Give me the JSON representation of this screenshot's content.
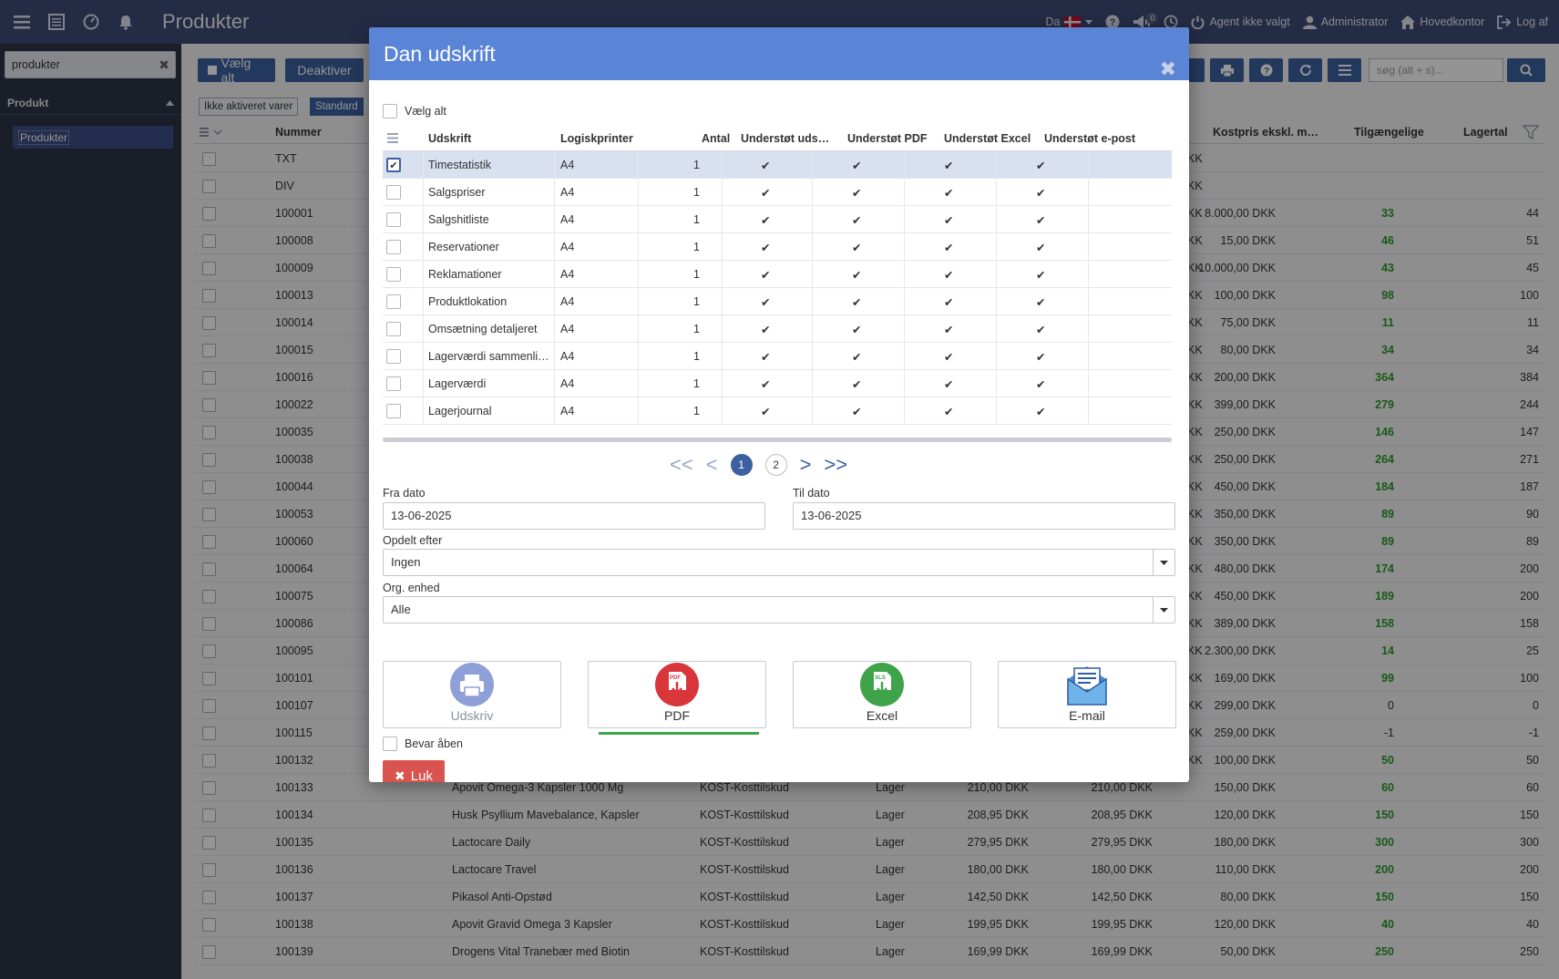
{
  "topbar": {
    "title": "Produkter",
    "language": "Da",
    "notification_count": "0",
    "agent": "Agent ikke valgt",
    "user": "Administrator",
    "office": "Hovedkontor",
    "logout": "Log af"
  },
  "sidebar": {
    "search_value": "produkter",
    "section": "Produkt",
    "item": "Produkter"
  },
  "toolbar": {
    "select_all": "Vælg alt",
    "deactivate": "Deaktiver",
    "search_placeholder": "søg (alt + s)..."
  },
  "filters": [
    "Ikke aktiveret varer",
    "Standard"
  ],
  "grid": {
    "headers": {
      "number": "Nummer",
      "cost": "Kostpris ekskl. m…",
      "available": "Tilgængelige",
      "stock": "Lagertal"
    },
    "rows": [
      {
        "num": "TXT",
        "name": "",
        "group": "",
        "type": "",
        "p1": "",
        "p2": "",
        "p3": "KK",
        "cost": "",
        "avail": "",
        "stock": ""
      },
      {
        "num": "DIV",
        "name": "",
        "group": "",
        "type": "",
        "p1": "",
        "p2": "",
        "p3": "KK",
        "cost": "",
        "avail": "",
        "stock": ""
      },
      {
        "num": "100001",
        "name": "",
        "group": "",
        "type": "",
        "p1": "",
        "p2": "",
        "p3": "KK",
        "cost": "8.000,00 DKK",
        "avail": "33",
        "stock": "44"
      },
      {
        "num": "100008",
        "name": "",
        "group": "",
        "type": "",
        "p1": "",
        "p2": "",
        "p3": "KK",
        "cost": "15,00 DKK",
        "avail": "46",
        "stock": "51"
      },
      {
        "num": "100009",
        "name": "",
        "group": "",
        "type": "",
        "p1": "",
        "p2": "",
        "p3": "KK",
        "cost": "10.000,00 DKK",
        "avail": "43",
        "stock": "45"
      },
      {
        "num": "100013",
        "name": "",
        "group": "",
        "type": "",
        "p1": "",
        "p2": "",
        "p3": "KK",
        "cost": "100,00 DKK",
        "avail": "98",
        "stock": "100"
      },
      {
        "num": "100014",
        "name": "",
        "group": "",
        "type": "",
        "p1": "",
        "p2": "",
        "p3": "KK",
        "cost": "75,00 DKK",
        "avail": "11",
        "stock": "11"
      },
      {
        "num": "100015",
        "name": "",
        "group": "",
        "type": "",
        "p1": "",
        "p2": "",
        "p3": "KK",
        "cost": "80,00 DKK",
        "avail": "34",
        "stock": "34"
      },
      {
        "num": "100016",
        "name": "",
        "group": "",
        "type": "",
        "p1": "",
        "p2": "",
        "p3": "KK",
        "cost": "200,00 DKK",
        "avail": "364",
        "stock": "384"
      },
      {
        "num": "100022",
        "name": "",
        "group": "",
        "type": "",
        "p1": "",
        "p2": "",
        "p3": "KK",
        "cost": "399,00 DKK",
        "avail": "279",
        "stock": "244"
      },
      {
        "num": "100035",
        "name": "",
        "group": "",
        "type": "",
        "p1": "",
        "p2": "",
        "p3": "KK",
        "cost": "250,00 DKK",
        "avail": "146",
        "stock": "147"
      },
      {
        "num": "100038",
        "name": "",
        "group": "",
        "type": "",
        "p1": "",
        "p2": "",
        "p3": "KK",
        "cost": "250,00 DKK",
        "avail": "264",
        "stock": "271"
      },
      {
        "num": "100044",
        "name": "",
        "group": "",
        "type": "",
        "p1": "",
        "p2": "",
        "p3": "KK",
        "cost": "450,00 DKK",
        "avail": "184",
        "stock": "187"
      },
      {
        "num": "100053",
        "name": "",
        "group": "",
        "type": "",
        "p1": "",
        "p2": "",
        "p3": "KK",
        "cost": "350,00 DKK",
        "avail": "89",
        "stock": "90"
      },
      {
        "num": "100060",
        "name": "",
        "group": "",
        "type": "",
        "p1": "",
        "p2": "",
        "p3": "KK",
        "cost": "350,00 DKK",
        "avail": "89",
        "stock": "89"
      },
      {
        "num": "100064",
        "name": "",
        "group": "",
        "type": "",
        "p1": "",
        "p2": "",
        "p3": "KK",
        "cost": "480,00 DKK",
        "avail": "174",
        "stock": "200"
      },
      {
        "num": "100075",
        "name": "",
        "group": "",
        "type": "",
        "p1": "",
        "p2": "",
        "p3": "KK",
        "cost": "450,00 DKK",
        "avail": "189",
        "stock": "200"
      },
      {
        "num": "100086",
        "name": "",
        "group": "",
        "type": "",
        "p1": "",
        "p2": "",
        "p3": "KK",
        "cost": "389,00 DKK",
        "avail": "158",
        "stock": "158"
      },
      {
        "num": "100095",
        "name": "",
        "group": "",
        "type": "",
        "p1": "",
        "p2": "",
        "p3": "KK",
        "cost": "2.300,00 DKK",
        "avail": "14",
        "stock": "25"
      },
      {
        "num": "100101",
        "name": "",
        "group": "",
        "type": "",
        "p1": "",
        "p2": "",
        "p3": "KK",
        "cost": "169,00 DKK",
        "avail": "99",
        "stock": "100"
      },
      {
        "num": "100107",
        "name": "",
        "group": "",
        "type": "",
        "p1": "",
        "p2": "",
        "p3": "KK",
        "cost": "299,00 DKK",
        "avail": "0",
        "stock": "0"
      },
      {
        "num": "100115",
        "name": "",
        "group": "",
        "type": "",
        "p1": "",
        "p2": "",
        "p3": "KK",
        "cost": "259,00 DKK",
        "avail": "-1",
        "stock": "-1"
      },
      {
        "num": "100132",
        "name": "",
        "group": "",
        "type": "",
        "p1": "",
        "p2": "",
        "p3": "KK",
        "cost": "100,00 DKK",
        "avail": "50",
        "stock": "50"
      },
      {
        "num": "100133",
        "name": "Apovit Omega-3 Kapsler 1000 Mg",
        "group": "KOST-Kosttilskud",
        "type": "Lager",
        "p1": "210,00 DKK",
        "p2": "210,00 DKK",
        "p3": "",
        "cost": "150,00 DKK",
        "avail": "60",
        "stock": "60"
      },
      {
        "num": "100134",
        "name": "Husk Psyllium Mavebalance, Kapsler",
        "group": "KOST-Kosttilskud",
        "type": "Lager",
        "p1": "208,95 DKK",
        "p2": "208,95 DKK",
        "p3": "",
        "cost": "120,00 DKK",
        "avail": "150",
        "stock": "150"
      },
      {
        "num": "100135",
        "name": "Lactocare Daily",
        "group": "KOST-Kosttilskud",
        "type": "Lager",
        "p1": "279,95 DKK",
        "p2": "279,95 DKK",
        "p3": "",
        "cost": "180,00 DKK",
        "avail": "300",
        "stock": "300"
      },
      {
        "num": "100136",
        "name": "Lactocare Travel",
        "group": "KOST-Kosttilskud",
        "type": "Lager",
        "p1": "180,00 DKK",
        "p2": "180,00 DKK",
        "p3": "",
        "cost": "110,00 DKK",
        "avail": "200",
        "stock": "200"
      },
      {
        "num": "100137",
        "name": "Pikasol Anti-Opstød",
        "group": "KOST-Kosttilskud",
        "type": "Lager",
        "p1": "142,50 DKK",
        "p2": "142,50 DKK",
        "p3": "",
        "cost": "80,00 DKK",
        "avail": "150",
        "stock": "150"
      },
      {
        "num": "100138",
        "name": "Apovit Gravid Omega 3 Kapsler",
        "group": "KOST-Kosttilskud",
        "type": "Lager",
        "p1": "199,95 DKK",
        "p2": "199,95 DKK",
        "p3": "",
        "cost": "120,00 DKK",
        "avail": "40",
        "stock": "40"
      },
      {
        "num": "100139",
        "name": "Drogens Vital Tranebær med Biotin",
        "group": "KOST-Kosttilskud",
        "type": "Lager",
        "p1": "169,99 DKK",
        "p2": "169,99 DKK",
        "p3": "",
        "cost": "50,00 DKK",
        "avail": "250",
        "stock": "250"
      }
    ]
  },
  "modal": {
    "title": "Dan udskrift",
    "select_all": "Vælg alt",
    "columns": [
      "Udskrift",
      "Logiskprinter",
      "Antal",
      "Understøt uds…",
      "Understøt PDF",
      "Understøt Excel",
      "Understøt e-post"
    ],
    "reports": [
      {
        "name": "Timestatistik",
        "printer": "A4",
        "count": "1",
        "checked": true
      },
      {
        "name": "Salgspriser",
        "printer": "A4",
        "count": "1",
        "checked": false
      },
      {
        "name": "Salgshitliste",
        "printer": "A4",
        "count": "1",
        "checked": false
      },
      {
        "name": "Reservationer",
        "printer": "A4",
        "count": "1",
        "checked": false
      },
      {
        "name": "Reklamationer",
        "printer": "A4",
        "count": "1",
        "checked": false
      },
      {
        "name": "Produktlokation",
        "printer": "A4",
        "count": "1",
        "checked": false
      },
      {
        "name": "Omsætning detaljeret",
        "printer": "A4",
        "count": "1",
        "checked": false
      },
      {
        "name": "Lagerværdi sammenli…",
        "printer": "A4",
        "count": "1",
        "checked": false
      },
      {
        "name": "Lagerværdi",
        "printer": "A4",
        "count": "1",
        "checked": false
      },
      {
        "name": "Lagerjournal",
        "printer": "A4",
        "count": "1",
        "checked": false
      }
    ],
    "check_glyph": "✔",
    "pager": {
      "first": "<<",
      "prev": "<",
      "pages": [
        "1",
        "2"
      ],
      "next": ">",
      "last": ">>"
    },
    "from_label": "Fra dato",
    "from_value": "13-06-2025",
    "to_label": "Til dato",
    "to_value": "13-06-2025",
    "split_label": "Opdelt efter",
    "split_value": "Ingen",
    "org_label": "Org. enhed",
    "org_value": "Alle",
    "actions": {
      "print": "Udskriv",
      "pdf": "PDF",
      "excel": "Excel",
      "email": "E-mail"
    },
    "keep_open": "Bevar åben",
    "close": "Luk"
  }
}
